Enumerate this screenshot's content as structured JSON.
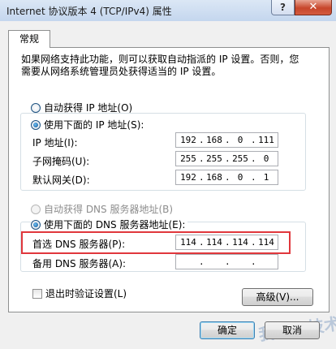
{
  "window": {
    "title": "Internet 协议版本 4 (TCP/IPv4) 属性",
    "help_label": "?",
    "close_label": "✕"
  },
  "tab": {
    "label": "常规"
  },
  "description": "如果网络支持此功能，则可以获取自动指派的 IP 设置。否则，您需要从网络系统管理员处获得适当的 IP 设置。",
  "ip": {
    "auto_label": "自动获得 IP 地址(O)",
    "manual_label": "使用下面的 IP 地址(S):",
    "selected": "manual",
    "address_label": "IP 地址(I):",
    "address": [
      "192",
      "168",
      "0",
      "111"
    ],
    "mask_label": "子网掩码(U):",
    "mask": [
      "255",
      "255",
      "255",
      "0"
    ],
    "gateway_label": "默认网关(D):",
    "gateway": [
      "192",
      "168",
      "0",
      "1"
    ]
  },
  "dns": {
    "auto_label": "自动获得 DNS 服务器地址(B)",
    "manual_label": "使用下面的 DNS 服务器地址(E):",
    "selected": "manual",
    "preferred_label": "首选 DNS 服务器(P):",
    "preferred": [
      "114",
      "114",
      "114",
      "114"
    ],
    "alternate_label": "备用 DNS 服务器(A):",
    "alternate": [
      "",
      "",
      "",
      ""
    ]
  },
  "validate_label": "退出时验证设置(L)",
  "validate_checked": false,
  "advanced_label": "高级(V)...",
  "ok_label": "确定",
  "cancel_label": "取消",
  "watermark": "我爱IT技术网",
  "colors": {
    "highlight": "#e0373c",
    "titlebar": "#c4d6ee"
  }
}
